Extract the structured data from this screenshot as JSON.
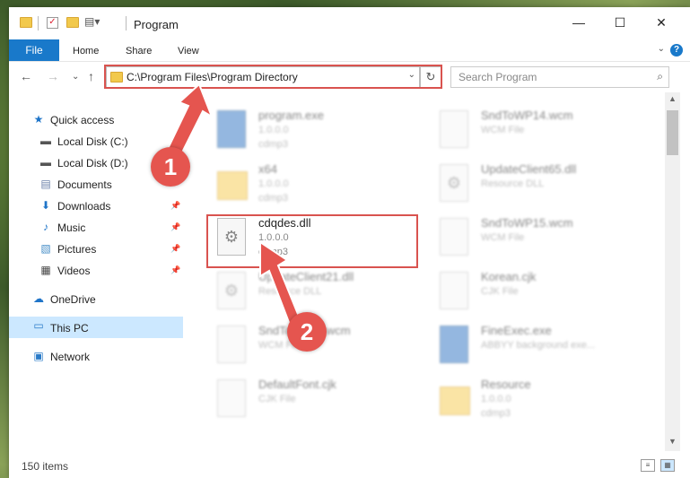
{
  "window": {
    "title": "Program",
    "controls": {
      "minimize": "—",
      "maximize": "☐",
      "close": "✕"
    }
  },
  "ribbon": {
    "tabs": [
      "File",
      "Home",
      "Share",
      "View"
    ],
    "help": "?",
    "expand": "⌄"
  },
  "navigation": {
    "back": "←",
    "forward": "→",
    "recent": "⌄",
    "up": "↑",
    "address": "C:\\Program Files\\Program Directory",
    "address_dropdown": "⌄",
    "refresh": "↻",
    "search_placeholder": "Search Program",
    "search_icon": "⌕"
  },
  "sidebar": {
    "items": [
      {
        "label": "Quick access",
        "icon": "star-icon",
        "glyph": "★",
        "color": "#1e74c8"
      },
      {
        "label": "Local Disk (C:)",
        "icon": "drive-icon",
        "glyph": "▬",
        "color": "#555555",
        "pinned": true
      },
      {
        "label": "Local Disk (D:)",
        "icon": "drive-icon",
        "glyph": "▬",
        "color": "#555555"
      },
      {
        "label": "Documents",
        "icon": "documents-icon",
        "glyph": "▤",
        "color": "#6a7fa8"
      },
      {
        "label": "Downloads",
        "icon": "download-icon",
        "glyph": "⬇",
        "color": "#1e74c8",
        "pinned": true
      },
      {
        "label": "Music",
        "icon": "music-icon",
        "glyph": "♪",
        "color": "#1e74c8",
        "pinned": true
      },
      {
        "label": "Pictures",
        "icon": "pictures-icon",
        "glyph": "▧",
        "color": "#4a90c8",
        "pinned": true
      },
      {
        "label": "Videos",
        "icon": "videos-icon",
        "glyph": "▦",
        "color": "#444444",
        "pinned": true
      },
      {
        "label": "OneDrive",
        "icon": "cloud-icon",
        "glyph": "☁",
        "color": "#1e74c8"
      },
      {
        "label": "This PC",
        "icon": "computer-icon",
        "glyph": "▭",
        "color": "#2b7bc8",
        "selected": true
      },
      {
        "label": "Network",
        "icon": "network-icon",
        "glyph": "▣",
        "color": "#2b7bc8"
      }
    ],
    "pin_glyph": "📌"
  },
  "files": {
    "col1": [
      {
        "name": "program.exe",
        "line1": "1.0.0.0",
        "line2": "cdmp3",
        "type": "exe"
      },
      {
        "name": "x64",
        "line1": "1.0.0.0",
        "line2": "cdmp3",
        "type": "folder"
      },
      {
        "name": "cdqdes.dll",
        "line1": "1.0.0.0",
        "line2": "cdmp3",
        "type": "dll",
        "highlighted": true
      },
      {
        "name": "UpdateClient21.dll",
        "line1": "Resource DLL",
        "line2": "",
        "type": "dll"
      },
      {
        "name": "SndToWP14.wcm",
        "line1": "WCM File",
        "line2": "",
        "type": "file"
      },
      {
        "name": "DefaultFont.cjk",
        "line1": "CJK File",
        "line2": "",
        "type": "file"
      }
    ],
    "col2": [
      {
        "name": "SndToWP14.wcm",
        "line1": "WCM File",
        "line2": "",
        "type": "file"
      },
      {
        "name": "UpdateClient65.dll",
        "line1": "Resource DLL",
        "line2": "",
        "type": "dll"
      },
      {
        "name": "SndToWP15.wcm",
        "line1": "WCM File",
        "line2": "",
        "type": "file"
      },
      {
        "name": "Korean.cjk",
        "line1": "CJK File",
        "line2": "",
        "type": "file"
      },
      {
        "name": "FineExec.exe",
        "line1": "ABBYY background exe...",
        "line2": "",
        "type": "exe"
      },
      {
        "name": "Resource",
        "line1": "1.0.0.0",
        "line2": "cdmp3",
        "type": "folder"
      }
    ]
  },
  "status": {
    "item_count": "150 items",
    "details_view": "≡",
    "tiles_view": "▦"
  },
  "callouts": [
    "1",
    "2"
  ],
  "colors": {
    "accent": "#1979ca",
    "highlight": "#d9534f",
    "callout": "#e5554f",
    "selected_bg": "#cce8ff"
  }
}
